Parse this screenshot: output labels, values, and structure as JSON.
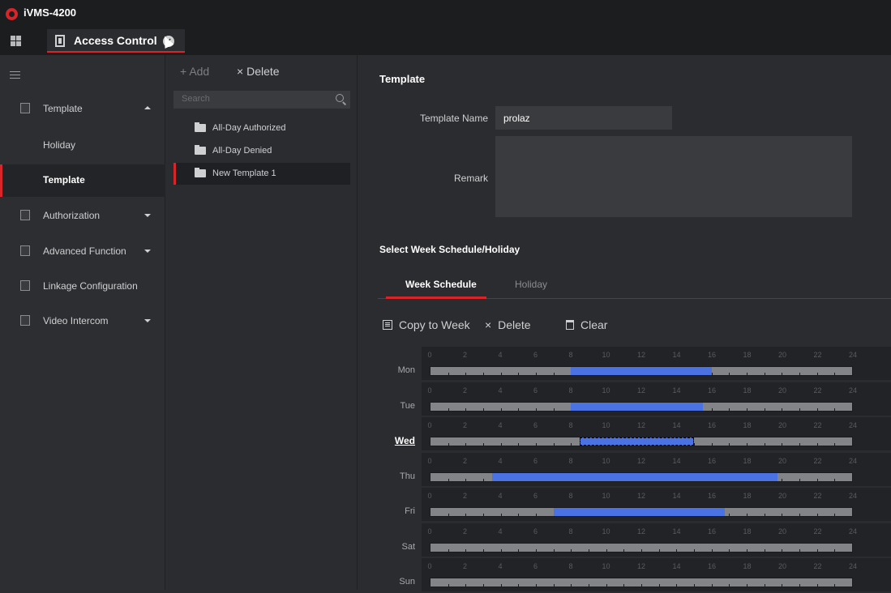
{
  "app": {
    "title": "iVMS-4200"
  },
  "tab": {
    "label": "Access Control"
  },
  "sidebar": {
    "items": [
      {
        "label": "Template",
        "icon": "edit-icon",
        "expanded": true
      },
      {
        "label": "Holiday",
        "sub": true
      },
      {
        "label": "Template",
        "sub": true,
        "active": true
      },
      {
        "label": "Authorization",
        "icon": "lock-icon"
      },
      {
        "label": "Advanced Function",
        "icon": "door-icon"
      },
      {
        "label": "Linkage Configuration",
        "icon": "linkage-icon"
      },
      {
        "label": "Video Intercom",
        "icon": "intercom-icon"
      }
    ]
  },
  "list": {
    "add_label": "Add",
    "delete_label": "Delete",
    "search_placeholder": "Search",
    "templates": [
      "All-Day Authorized",
      "All-Day Denied",
      "New Template 1"
    ]
  },
  "form": {
    "section_title": "Template",
    "name_label": "Template Name",
    "name_value": "prolaz",
    "remark_label": "Remark",
    "remark_value": "",
    "schedule_title": "Select Week Schedule/Holiday",
    "tabs": [
      "Week Schedule",
      "Holiday"
    ],
    "copy_label": "Copy to Week",
    "delete_label": "Delete",
    "clear_label": "Clear"
  },
  "schedule": {
    "ticks": [
      "0",
      "2",
      "4",
      "6",
      "8",
      "10",
      "12",
      "14",
      "16",
      "18",
      "20",
      "22",
      "24"
    ],
    "selected_day": "Wed",
    "days": [
      {
        "day": "Mon",
        "start": 8,
        "end": 16
      },
      {
        "day": "Tue",
        "start": 8,
        "end": 15.5
      },
      {
        "day": "Wed",
        "start": 8.5,
        "end": 15
      },
      {
        "day": "Thu",
        "start": 3.5,
        "end": 19.75
      },
      {
        "day": "Fri",
        "start": 7,
        "end": 16.75
      },
      {
        "day": "Sat",
        "start": null,
        "end": null
      },
      {
        "day": "Sun",
        "start": null,
        "end": null
      }
    ],
    "colors": {
      "fill": "#4a72e3",
      "track": "#838487",
      "accent": "#d8252a"
    }
  }
}
